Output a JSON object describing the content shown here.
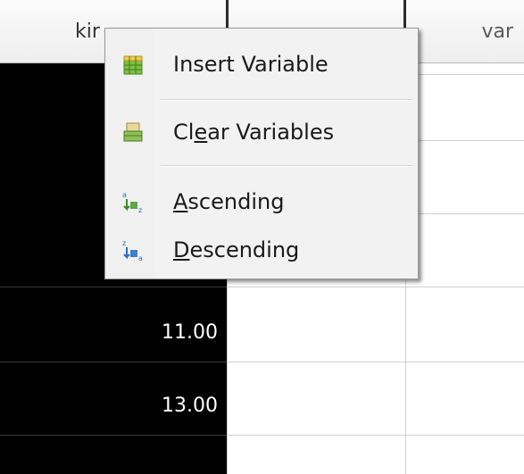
{
  "grid": {
    "columns": [
      {
        "header": "kir"
      },
      {
        "header": ""
      },
      {
        "header": "var"
      }
    ],
    "visible_values": [
      "11.00",
      "13.00"
    ]
  },
  "context_menu": {
    "items": [
      {
        "label": "Insert Variable",
        "icon": "insert-variable-icon",
        "mnemonic": ""
      },
      {
        "label": "Clear Variables",
        "icon": "clear-variables-icon",
        "mnemonic": "e"
      },
      {
        "label": "Ascending",
        "icon": "sort-ascending-icon",
        "mnemonic": "A"
      },
      {
        "label": "Descending",
        "icon": "sort-descending-icon",
        "mnemonic": "D"
      }
    ]
  },
  "colors": {
    "selected_column": "#000000",
    "menu_background": "#f2f2f2",
    "grid_line": "#cfcfcf"
  }
}
